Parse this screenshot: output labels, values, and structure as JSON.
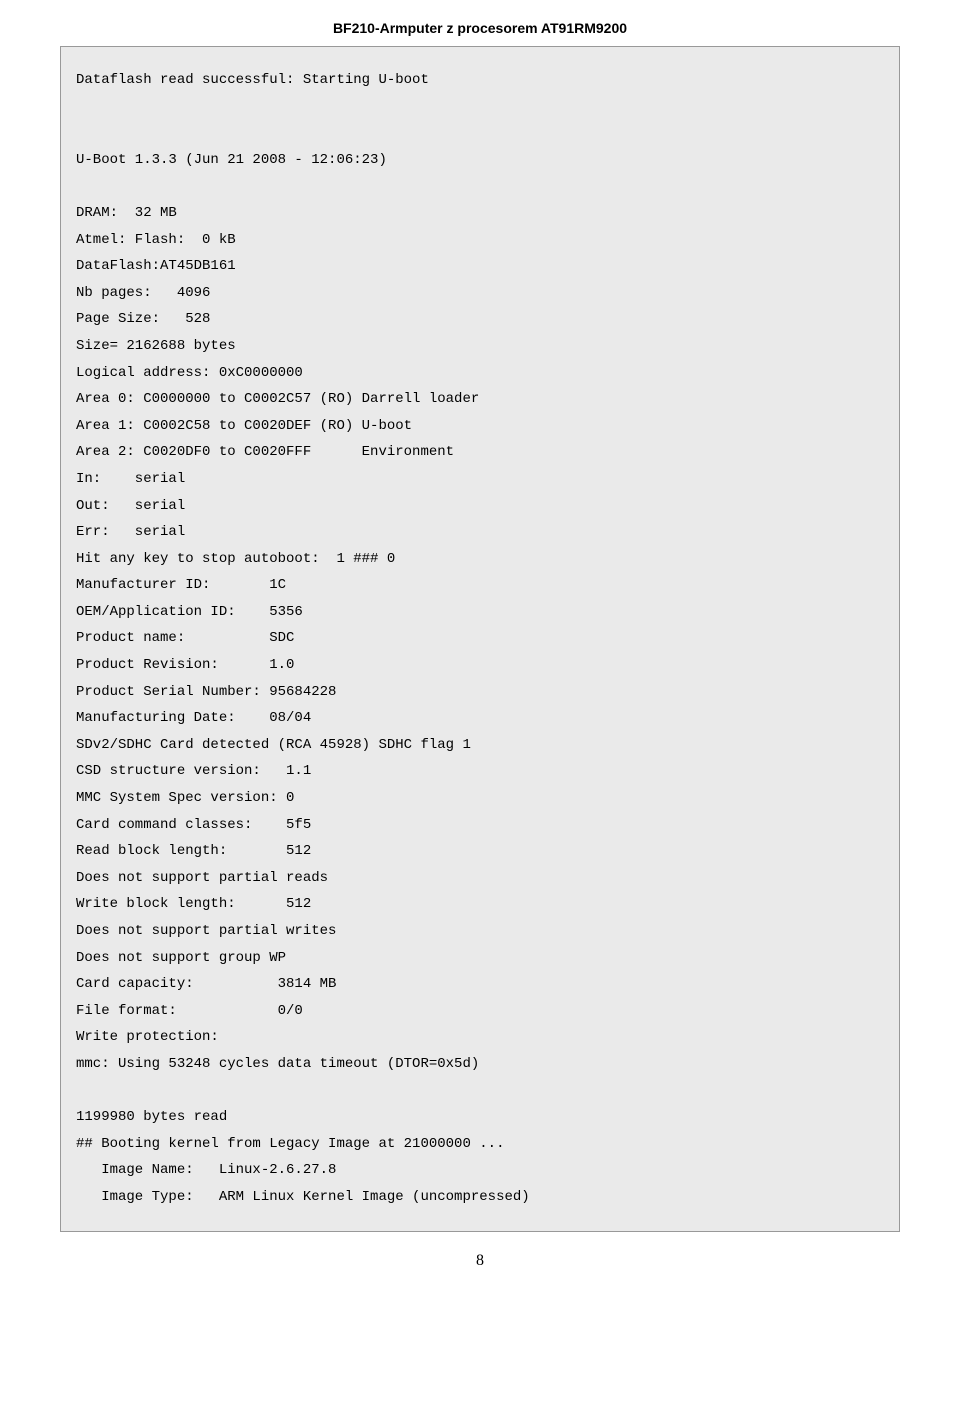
{
  "header": {
    "title": "BF210-Armputer z procesorem AT91RM9200"
  },
  "console": {
    "line01": "Dataflash read successful: Starting U-boot",
    "line02": "",
    "line03": "",
    "line04": "U-Boot 1.3.3 (Jun 21 2008 - 12:06:23)",
    "line05": "",
    "line06": "DRAM:  32 MB",
    "line07": "Atmel: Flash:  0 kB",
    "line08": "DataFlash:AT45DB161",
    "line09": "Nb pages:   4096",
    "line10": "Page Size:   528",
    "line11": "Size= 2162688 bytes",
    "line12": "Logical address: 0xC0000000",
    "line13": "Area 0: C0000000 to C0002C57 (RO) Darrell loader",
    "line14": "Area 1: C0002C58 to C0020DEF (RO) U-boot",
    "line15": "Area 2: C0020DF0 to C0020FFF      Environment",
    "line16": "In:    serial",
    "line17": "Out:   serial",
    "line18": "Err:   serial",
    "line19": "Hit any key to stop autoboot:  1 ### 0",
    "line20": "Manufacturer ID:       1C",
    "line21": "OEM/Application ID:    5356",
    "line22": "Product name:          SDC",
    "line23": "Product Revision:      1.0",
    "line24": "Product Serial Number: 95684228",
    "line25": "Manufacturing Date:    08/04",
    "line26": "SDv2/SDHC Card detected (RCA 45928) SDHC flag 1",
    "line27": "CSD structure version:   1.1",
    "line28": "MMC System Spec version: 0",
    "line29": "Card command classes:    5f5",
    "line30": "Read block length:       512",
    "line31": "Does not support partial reads",
    "line32": "Write block length:      512",
    "line33": "Does not support partial writes",
    "line34": "Does not support group WP",
    "line35": "Card capacity:          3814 MB",
    "line36": "File format:            0/0",
    "line37": "Write protection:",
    "line38": "mmc: Using 53248 cycles data timeout (DTOR=0x5d)",
    "line39": "",
    "line40": "1199980 bytes read",
    "line41": "## Booting kernel from Legacy Image at 21000000 ...",
    "line42": "   Image Name:   Linux-2.6.27.8",
    "line43": "   Image Type:   ARM Linux Kernel Image (uncompressed)"
  },
  "footer": {
    "page_number": "8"
  }
}
